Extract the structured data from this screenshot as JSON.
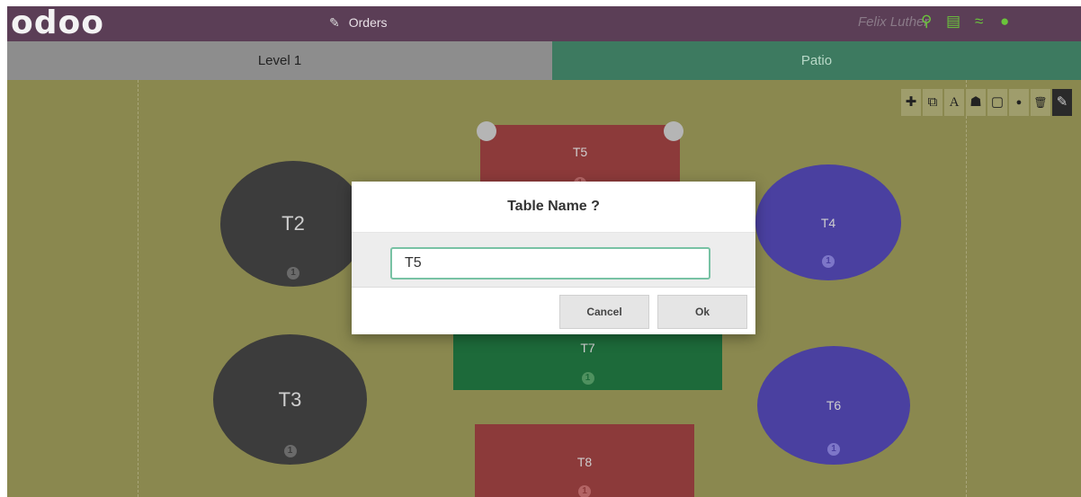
{
  "header": {
    "logo": "odoo",
    "orders_icon": "tag-icon",
    "orders_label": "Orders",
    "username": "Felix Luther",
    "status_icons": [
      "search-icon",
      "monitor-icon",
      "wifi-icon",
      "circle-icon"
    ]
  },
  "levels": [
    {
      "label": "Level 1",
      "color": "#8d8d8d"
    },
    {
      "label": "Patio",
      "color": "#3d7a60"
    }
  ],
  "toolbar": {
    "icons": [
      "plus-icon",
      "duplicate-icon",
      "rename-icon",
      "seats-icon",
      "shape-icon",
      "color-icon",
      "trash-icon",
      "edit-icon"
    ],
    "glyphs": [
      "✚",
      "⧉",
      "A",
      "☗",
      "▢",
      "●",
      "🗑",
      "✎"
    ]
  },
  "tables": [
    {
      "name": "T2",
      "seats": "1",
      "color": "dark"
    },
    {
      "name": "T3",
      "seats": "1",
      "color": "dark"
    },
    {
      "name": "T4",
      "seats": "1",
      "color": "blue"
    },
    {
      "name": "T5",
      "seats": "1",
      "color": "red"
    },
    {
      "name": "T6",
      "seats": "1",
      "color": "blue"
    },
    {
      "name": "T7",
      "seats": "1",
      "color": "green"
    },
    {
      "name": "T8",
      "seats": "1",
      "color": "red"
    }
  ],
  "modal": {
    "title": "Table Name ?",
    "input_value": "T5",
    "cancel_label": "Cancel",
    "ok_label": "Ok"
  },
  "colors": {
    "topbar": "#5b3e56",
    "floor": "#8a884f",
    "accent_green": "#6ac43b",
    "input_border": "#78c2a4"
  }
}
